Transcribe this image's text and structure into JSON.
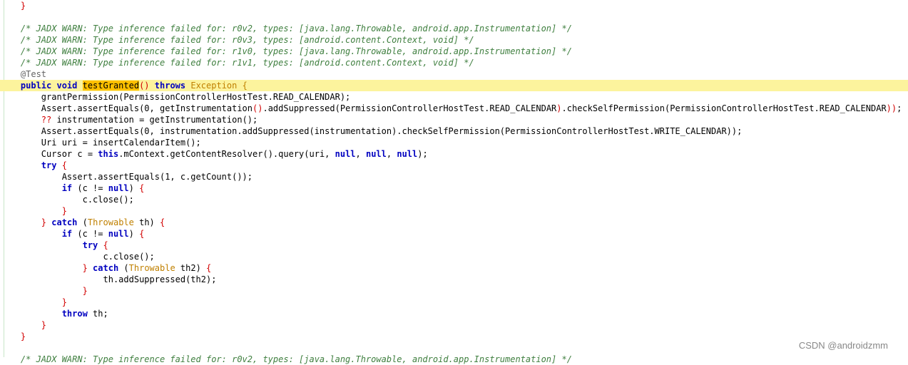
{
  "editor": {
    "lines": [
      [
        {
          "t": "    ",
          "c": "plain"
        },
        {
          "t": "}",
          "c": "br"
        }
      ],
      [
        {
          "t": "",
          "c": "plain"
        }
      ],
      [
        {
          "t": "    /* JADX WARN: Type inference failed for: r0v2, types: [java.lang.Throwable, android.app.Instrumentation] */",
          "c": "cm"
        }
      ],
      [
        {
          "t": "    /* JADX WARN: Type inference failed for: r0v3, types: [android.content.Context, void] */",
          "c": "cm"
        }
      ],
      [
        {
          "t": "    /* JADX WARN: Type inference failed for: r1v0, types: [java.lang.Throwable, android.app.Instrumentation] */",
          "c": "cm"
        }
      ],
      [
        {
          "t": "    /* JADX WARN: Type inference failed for: r1v1, types: [android.content.Context, void] */",
          "c": "cm"
        }
      ],
      [
        {
          "t": "    @Test",
          "c": "ann"
        }
      ],
      [
        {
          "t": "    public void ",
          "c": "kw"
        },
        {
          "t": "testGranted",
          "c": "sel"
        },
        {
          "t": "() ",
          "c": "br"
        },
        {
          "t": "throws ",
          "c": "kw"
        },
        {
          "t": "Exception {",
          "c": "ty"
        }
      ],
      [
        {
          "t": "        grantPermission(PermissionControllerHostTest.READ_CALENDAR);",
          "c": "plain"
        }
      ],
      [
        {
          "t": "        Assert.assertEquals(0, getInstrumentation",
          "c": "plain"
        },
        {
          "t": "()",
          "c": "br"
        },
        {
          "t": ".addSuppressed(PermissionControllerHostTest.READ_CALENDAR",
          "c": "plain"
        },
        {
          "t": ")",
          "c": "br"
        },
        {
          "t": ".checkSelfPermission(PermissionControllerHostTest.READ_CALENDAR",
          "c": "plain"
        },
        {
          "t": "))",
          "c": "br"
        },
        {
          "t": ";",
          "c": "plain"
        }
      ],
      [
        {
          "t": "        ?? ",
          "c": "br"
        },
        {
          "t": "instrumentation = getInstrumentation();",
          "c": "plain"
        }
      ],
      [
        {
          "t": "        Assert.assertEquals(0, instrumentation.addSuppressed(instrumentation).checkSelfPermission(PermissionControllerHostTest.WRITE_CALENDAR));",
          "c": "plain"
        }
      ],
      [
        {
          "t": "        Uri uri = insertCalendarItem();",
          "c": "plain"
        }
      ],
      [
        {
          "t": "        Cursor c = ",
          "c": "plain"
        },
        {
          "t": "this",
          "c": "kw"
        },
        {
          "t": ".mContext.getContentResolver().query(uri, ",
          "c": "plain"
        },
        {
          "t": "null",
          "c": "kw"
        },
        {
          "t": ", ",
          "c": "plain"
        },
        {
          "t": "null",
          "c": "kw"
        },
        {
          "t": ", ",
          "c": "plain"
        },
        {
          "t": "null",
          "c": "kw"
        },
        {
          "t": ");",
          "c": "plain"
        }
      ],
      [
        {
          "t": "        try ",
          "c": "kw"
        },
        {
          "t": "{",
          "c": "br"
        }
      ],
      [
        {
          "t": "            Assert.assertEquals(1, c.getCount());",
          "c": "plain"
        }
      ],
      [
        {
          "t": "            if ",
          "c": "kw"
        },
        {
          "t": "(c != ",
          "c": "plain"
        },
        {
          "t": "null",
          "c": "kw"
        },
        {
          "t": ") ",
          "c": "plain"
        },
        {
          "t": "{",
          "c": "br"
        }
      ],
      [
        {
          "t": "                c.close();",
          "c": "plain"
        }
      ],
      [
        {
          "t": "            }",
          "c": "br"
        }
      ],
      [
        {
          "t": "        } ",
          "c": "br"
        },
        {
          "t": "catch ",
          "c": "kw"
        },
        {
          "t": "(",
          "c": "plain"
        },
        {
          "t": "Throwable ",
          "c": "ty"
        },
        {
          "t": "th) ",
          "c": "plain"
        },
        {
          "t": "{",
          "c": "br"
        }
      ],
      [
        {
          "t": "            if ",
          "c": "kw"
        },
        {
          "t": "(c != ",
          "c": "plain"
        },
        {
          "t": "null",
          "c": "kw"
        },
        {
          "t": ") ",
          "c": "plain"
        },
        {
          "t": "{",
          "c": "br"
        }
      ],
      [
        {
          "t": "                try ",
          "c": "kw"
        },
        {
          "t": "{",
          "c": "br"
        }
      ],
      [
        {
          "t": "                    c.close();",
          "c": "plain"
        }
      ],
      [
        {
          "t": "                } ",
          "c": "br"
        },
        {
          "t": "catch ",
          "c": "kw"
        },
        {
          "t": "(",
          "c": "plain"
        },
        {
          "t": "Throwable ",
          "c": "ty"
        },
        {
          "t": "th2) ",
          "c": "plain"
        },
        {
          "t": "{",
          "c": "br"
        }
      ],
      [
        {
          "t": "                    th.addSuppressed(th2);",
          "c": "plain"
        }
      ],
      [
        {
          "t": "                }",
          "c": "br"
        }
      ],
      [
        {
          "t": "            }",
          "c": "br"
        }
      ],
      [
        {
          "t": "            throw ",
          "c": "kw"
        },
        {
          "t": "th;",
          "c": "plain"
        }
      ],
      [
        {
          "t": "        }",
          "c": "br"
        }
      ],
      [
        {
          "t": "    }",
          "c": "br"
        }
      ],
      [
        {
          "t": "",
          "c": "plain"
        }
      ],
      [
        {
          "t": "    /* JADX WARN: Type inference failed for: r0v2, types: [java.lang.Throwable, android.app.Instrumentation] */",
          "c": "cm"
        }
      ]
    ],
    "highlighted_line_index": 7
  },
  "watermark": "CSDN @androidzmm",
  "colors": {
    "background": "#ffffff",
    "comment": "#3f7f3f",
    "keyword": "#0000c0",
    "brace": "#d20000",
    "type": "#c08000",
    "line_highlight": "#fcf39d",
    "selection": "#ffc000"
  }
}
